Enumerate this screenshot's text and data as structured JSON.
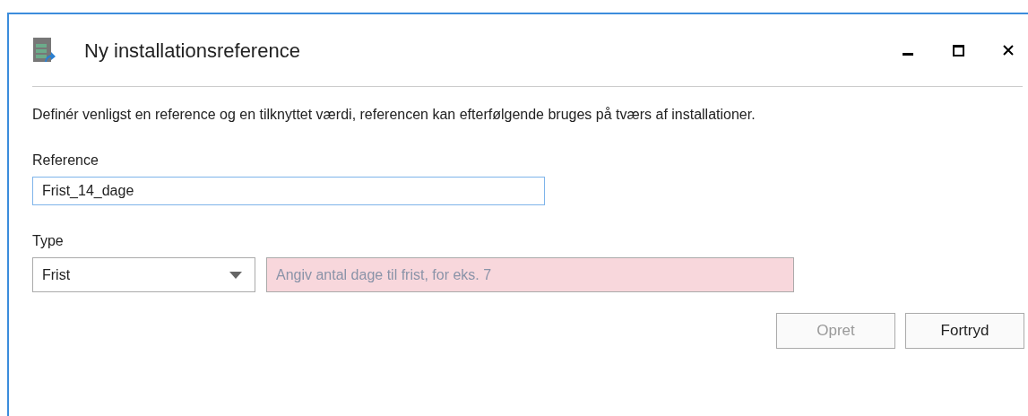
{
  "window": {
    "title": "Ny installationsreference"
  },
  "description": "Definér venligst en reference og en tilknyttet værdi, referencen kan efterfølgende bruges på tværs af installationer.",
  "reference": {
    "label": "Reference",
    "value": "Frist_14_dage",
    "focused": true
  },
  "type": {
    "label": "Type",
    "value": "Frist"
  },
  "value_field": {
    "placeholder": "Angiv antal dage til frist, for eks. 7",
    "invalid": true
  },
  "buttons": [
    {
      "label": "Opret",
      "disabled": true
    },
    {
      "label": "Fortryd",
      "disabled": false
    }
  ]
}
